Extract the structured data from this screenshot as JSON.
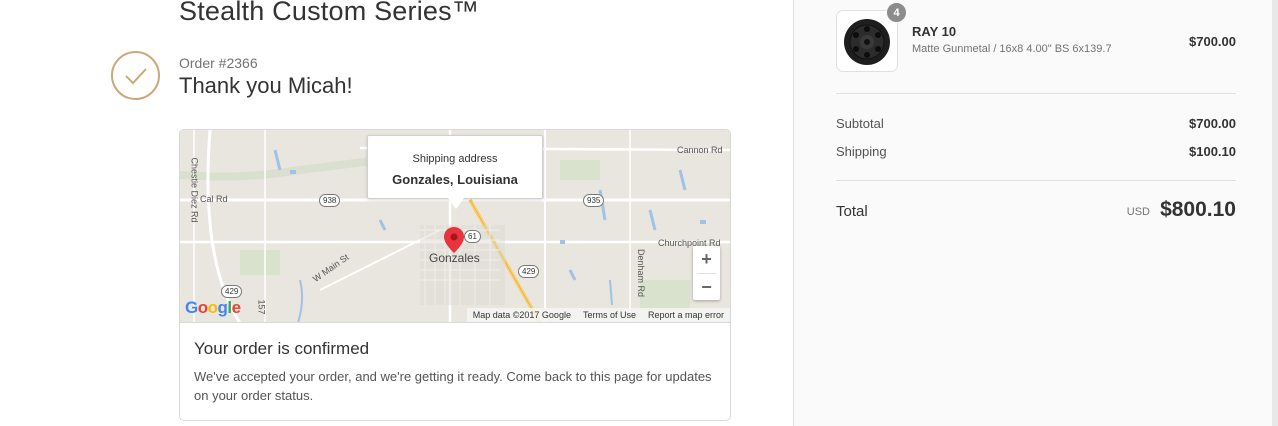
{
  "shop": {
    "title": "Stealth Custom Series™"
  },
  "order": {
    "number": "Order #2366",
    "greeting": "Thank you Micah!"
  },
  "map": {
    "popup_caption": "Shipping address",
    "popup_address": "Gonzales, Louisiana",
    "town": "Gonzales",
    "roads": [
      "Cannon Rd",
      "Cal Rd",
      "Churchpoint Rd",
      "W Main St",
      "Chestie Diez Rd",
      "Denham Rd"
    ],
    "routes": [
      "938",
      "935",
      "61",
      "429",
      "429",
      "157"
    ],
    "zoom_in": "+",
    "zoom_out": "−",
    "attribution": [
      "Map data ©2017 Google",
      "Terms of Use",
      "Report a map error"
    ]
  },
  "confirmation": {
    "title": "Your order is confirmed",
    "text": "We've accepted your order, and we're getting it ready. Come back to this page for updates on your order status."
  },
  "summary": {
    "item": {
      "quantity": "4",
      "name": "RAY 10",
      "variant": "Matte Gunmetal / 16x8 4.00\" BS 6x139.7",
      "price": "$700.00"
    },
    "subtotal_label": "Subtotal",
    "subtotal_value": "$700.00",
    "shipping_label": "Shipping",
    "shipping_value": "$100.10",
    "total_label": "Total",
    "currency": "USD",
    "total_value": "$800.10"
  },
  "colors": {
    "accent": "#c9a977",
    "pin": "#e8343c",
    "sidebar_bg": "#fafafa"
  }
}
